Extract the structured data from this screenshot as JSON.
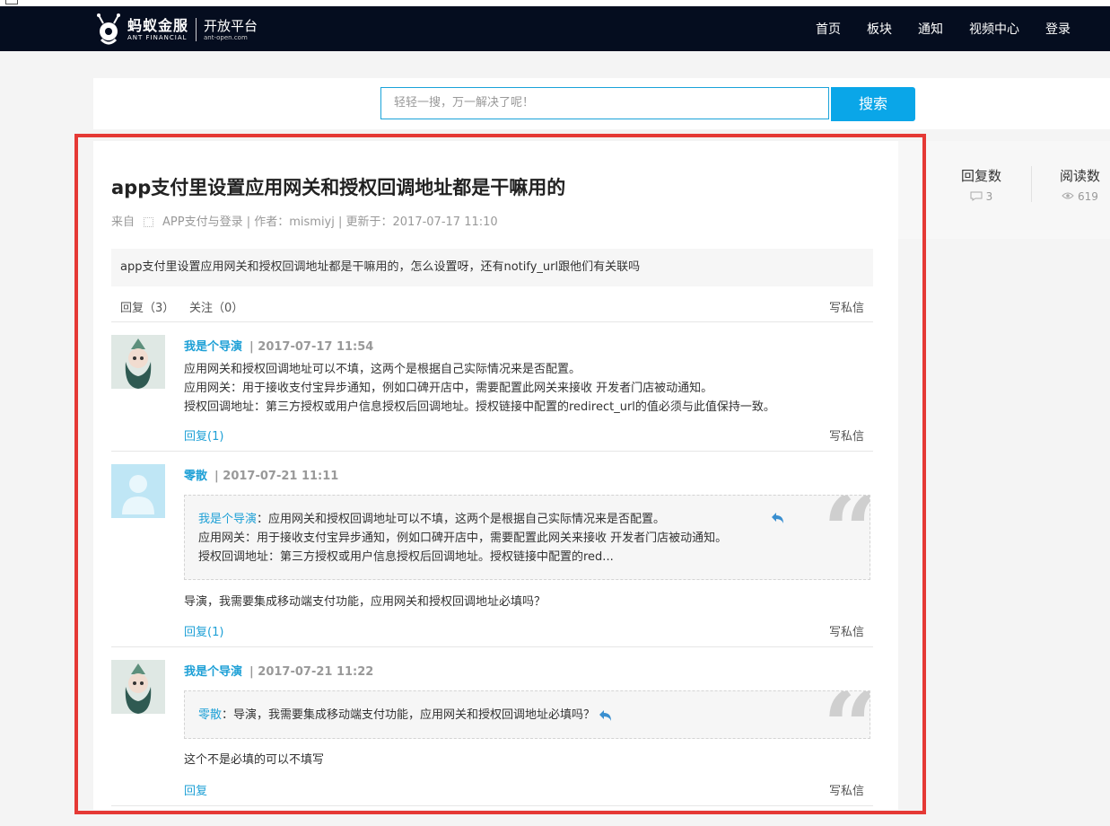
{
  "header": {
    "brand_cn": "蚂蚁金服",
    "brand_en": "ANT FINANCIAL",
    "platform_cn": "开放平台",
    "platform_en": "ant-open.com",
    "nav": [
      "首页",
      "板块",
      "通知",
      "视频中心",
      "登录"
    ]
  },
  "search": {
    "placeholder": "轻轻一搜，万一解决了呢！",
    "button": "搜索"
  },
  "stats": {
    "replies_label": "回复数",
    "replies_value": "3",
    "reads_label": "阅读数",
    "reads_value": "619"
  },
  "post": {
    "title": "app支付里设置应用网关和授权回调地址都是干嘛用的",
    "meta_from": "来自",
    "meta_rest": "APP支付与登录 | 作者：mismiyj  |  更新于：2017-07-17 11:10",
    "question": "app支付里设置应用网关和授权回调地址都是干嘛用的，怎么设置呀，还有notify_url跟他们有关联吗",
    "tab_reply": "回复（3）",
    "tab_follow": "关注（0）",
    "private_msg": "写私信"
  },
  "replies": [
    {
      "author": "我是个导演",
      "date": "| 2017-07-17 11:54",
      "lines": [
        "应用网关和授权回调地址可以不填，这两个是根据自己实际情况来是否配置。",
        "应用网关：用于接收支付宝异步通知，例如口碑开店中，需要配置此网关来接收 开发者门店被动通知。",
        "授权回调地址：第三方授权或用户信息授权后回调地址。授权链接中配置的redirect_url的值必须与此值保持一致。"
      ],
      "reply_link": "回复(1)",
      "private_msg": "写私信"
    },
    {
      "author": "零散",
      "date": "| 2017-07-21 11:11",
      "quote_author": "我是个导演",
      "quote_lines": [
        "：应用网关和授权回调地址可以不填，这两个是根据自己实际情况来是否配置。",
        "应用网关：用于接收支付宝异步通知，例如口碑开店中，需要配置此网关来接收 开发者门店被动通知。",
        "授权回调地址：第三方授权或用户信息授权后回调地址。授权链接中配置的red..."
      ],
      "text": "导演，我需要集成移动端支付功能，应用网关和授权回调地址必填吗？",
      "reply_link": "回复(1)",
      "private_msg": "写私信"
    },
    {
      "author": "我是个导演",
      "date": "| 2017-07-21 11:22",
      "quote_author": "零散",
      "quote_text": "：导演，我需要集成移动端支付功能，应用网关和授权回调地址必填吗？",
      "text": "这个不是必填的可以不填写",
      "reply_link": "回复",
      "private_msg": "写私信"
    }
  ],
  "colors": {
    "header_bg": "#050d1f",
    "accent": "#0aa6e8",
    "link": "#1ea0d6",
    "highlight_frame": "#e53935"
  }
}
